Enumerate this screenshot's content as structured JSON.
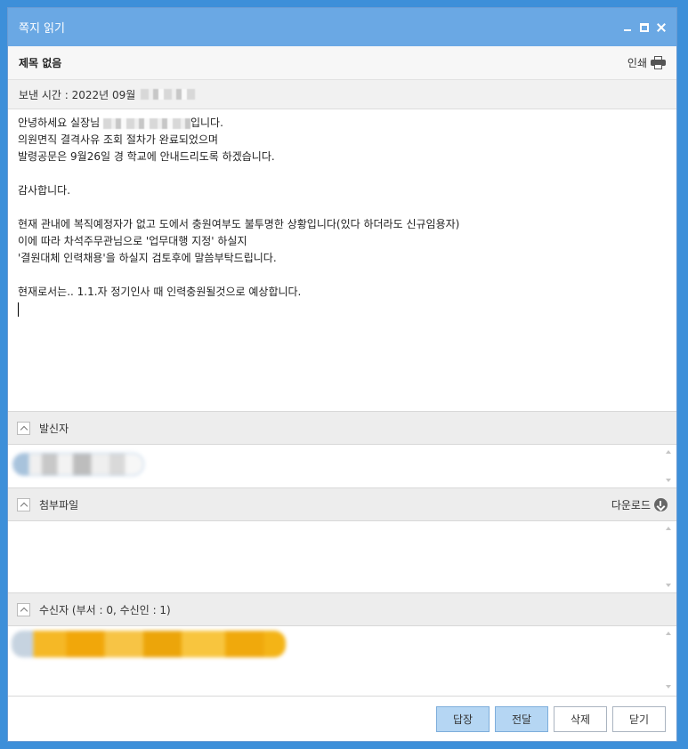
{
  "window": {
    "title": "쪽지 읽기"
  },
  "subject": "제목 없음",
  "print_label": "인쇄",
  "sent_time": "보낸 시간 : 2022년 09월",
  "body": {
    "greeting_pre": "안녕하세요 실장님",
    "greeting_post": "입니다.",
    "lines": [
      "의원면직 결격사유 조회 절차가 완료되었으며",
      "발령공문은 9월26일 경 학교에 안내드리도록 하겠습니다.",
      "",
      "감사합니다.",
      "",
      "현재 관내에 복직예정자가 없고 도에서 충원여부도 불투명한 상황입니다(있다 하더라도 신규임용자)",
      "이에 따라 차석주무관님으로 '업무대행 지정' 하실지",
      "'결원대체 인력채용'을 하실지 검토후에 말씀부탁드립니다.",
      "",
      "현재로서는.. 1.1.자 정기인사 때 인력충원될것으로 예상합니다."
    ]
  },
  "sections": {
    "sender": {
      "label": "발신자"
    },
    "attachments": {
      "label": "첨부파일",
      "download_label": "다운로드"
    },
    "recipients": {
      "label": "수신자 (부서 : 0, 수신인 : 1)"
    }
  },
  "buttons": {
    "reply": "답장",
    "forward": "전달",
    "delete": "삭제",
    "close": "닫기"
  },
  "colors": {
    "titlebar": "#6aa8e4",
    "primary_button": "#b5d6f3",
    "recipient_chip": "#f1a70a"
  }
}
